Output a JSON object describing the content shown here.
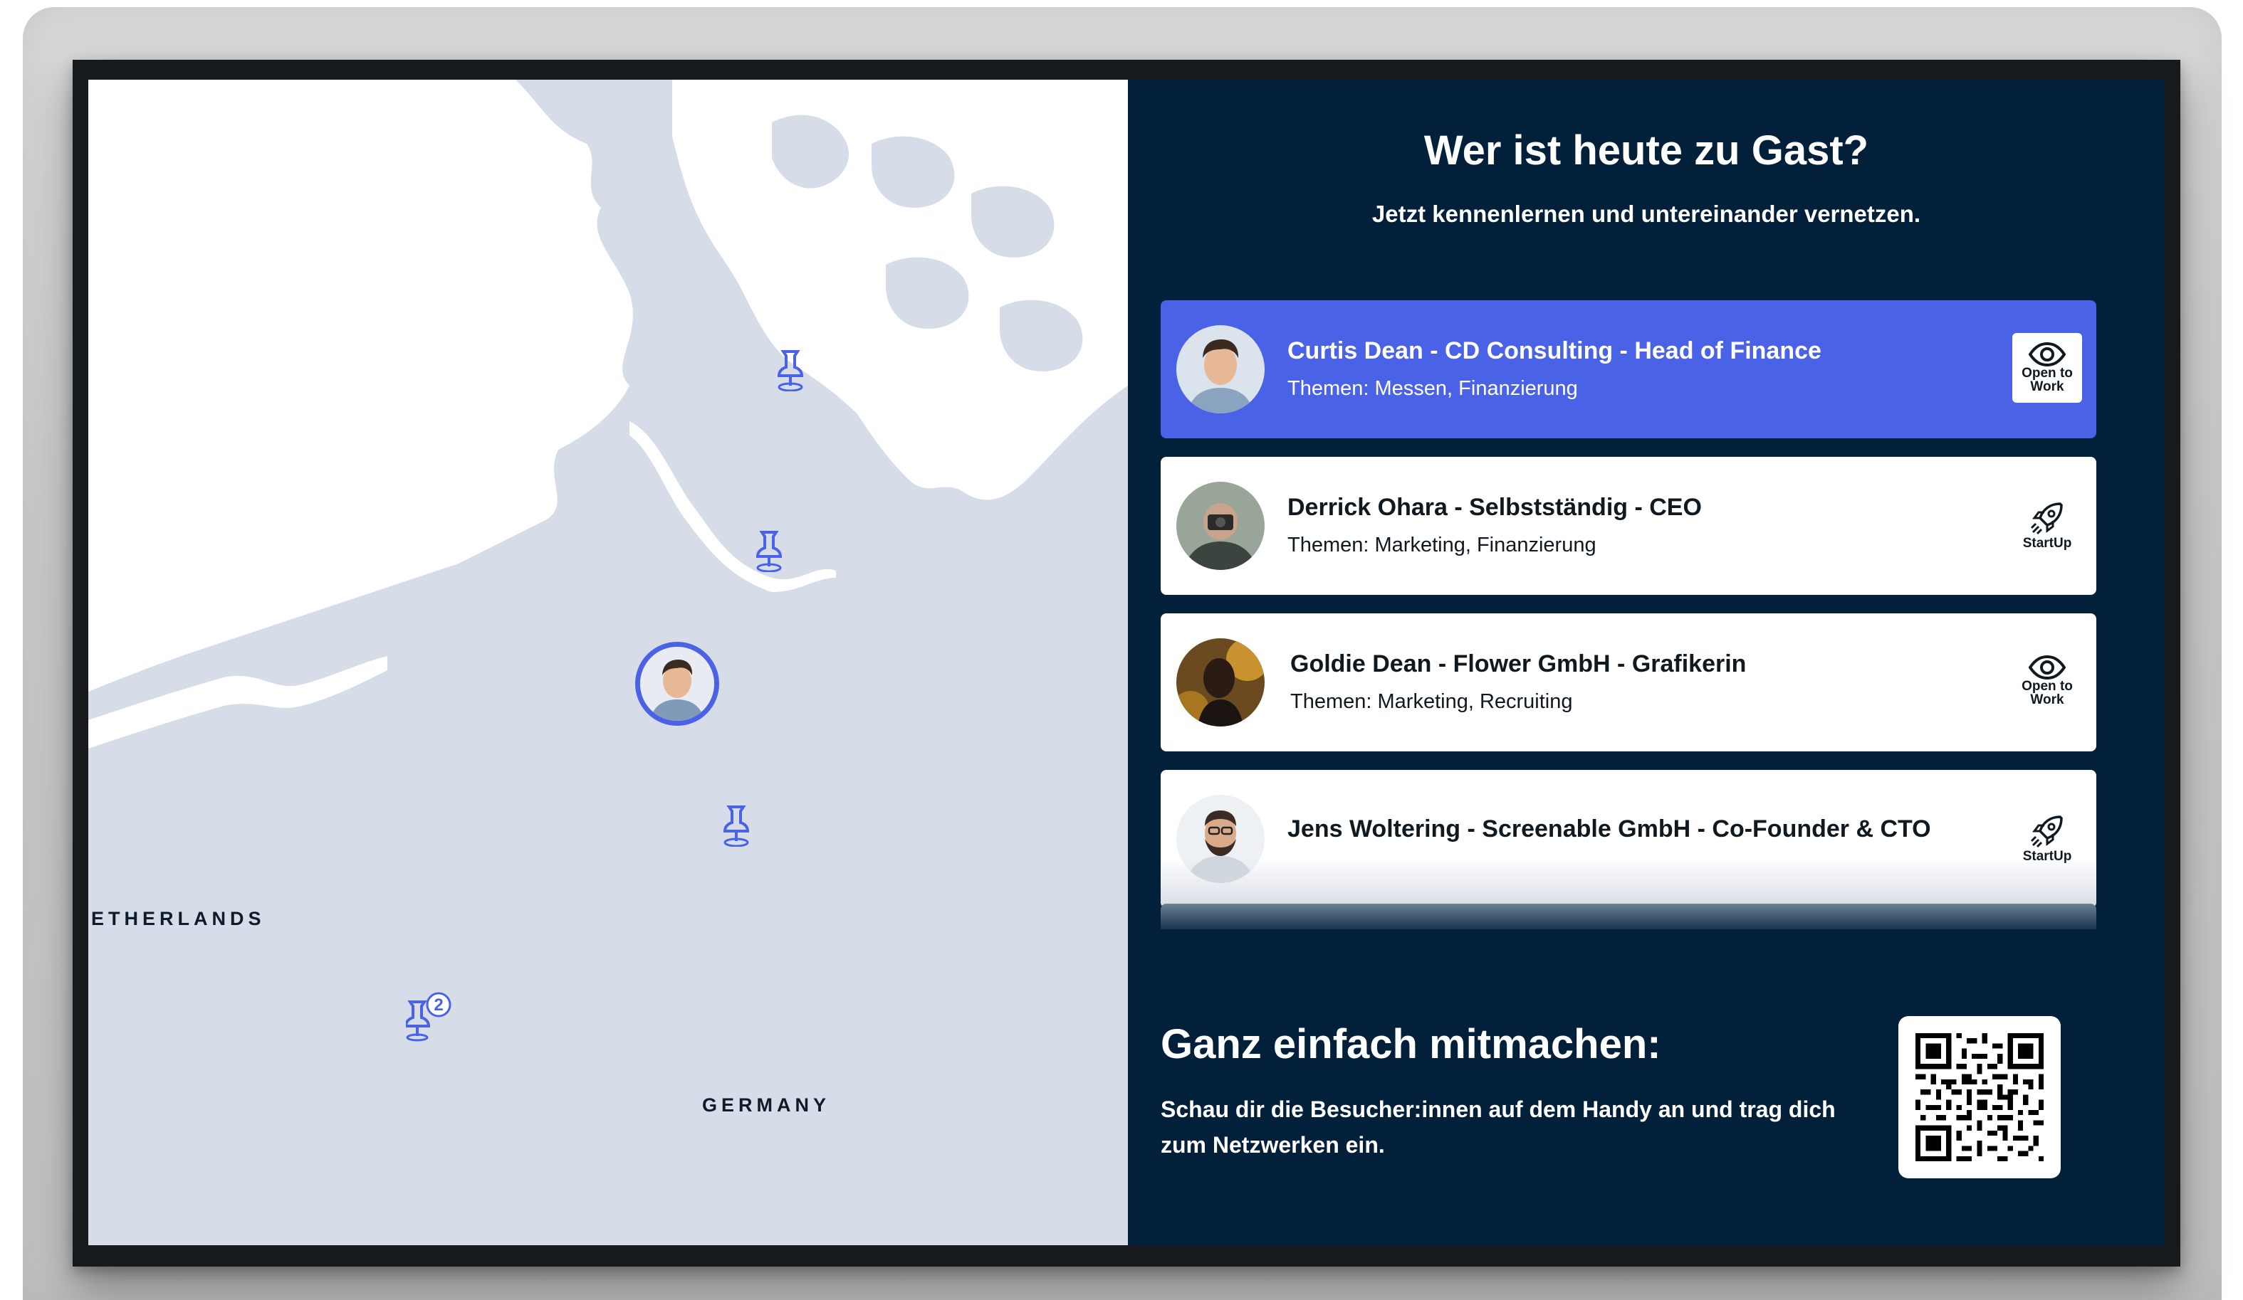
{
  "map": {
    "labels": {
      "netherlands": "ETHERLANDS",
      "germany": "GERMANY"
    },
    "cluster_count": "2",
    "colors": {
      "water": "#d6dde8",
      "land": "#ffffff",
      "pin": "#4a63e6"
    }
  },
  "panel": {
    "title": "Wer ist heute zu Gast?",
    "subtitle": "Jetzt kennenlernen und untereinander vernetzen.",
    "guests": [
      {
        "name": "Curtis Dean - CD Consulting - Head of Finance",
        "topics": "Themen: Messen, Finanzierung",
        "badge_icon": "eye-icon",
        "badge_label_1": "Open to",
        "badge_label_2": "Work",
        "active": true
      },
      {
        "name": "Derrick Ohara - Selbstständig - CEO",
        "topics": "Themen: Marketing, Finanzierung",
        "badge_icon": "rocket-icon",
        "badge_label_1": "StartUp",
        "badge_label_2": "",
        "active": false
      },
      {
        "name": "Goldie Dean - Flower GmbH - Grafikerin",
        "topics": "Themen: Marketing, Recruiting",
        "badge_icon": "eye-icon",
        "badge_label_1": "Open to",
        "badge_label_2": "Work",
        "active": false
      },
      {
        "name": "Jens Woltering - Screenable GmbH - Co-Founder & CTO",
        "topics": "",
        "badge_icon": "rocket-icon",
        "badge_label_1": "StartUp",
        "badge_label_2": "",
        "active": false
      }
    ],
    "cta": {
      "title": "Ganz einfach mitmachen:",
      "text": "Schau dir die Besucher:innen auf dem Handy an und trag dich zum Netzwerken ein."
    },
    "colors": {
      "background": "#03203b",
      "active_card": "#4a63e6",
      "card": "#ffffff"
    }
  }
}
